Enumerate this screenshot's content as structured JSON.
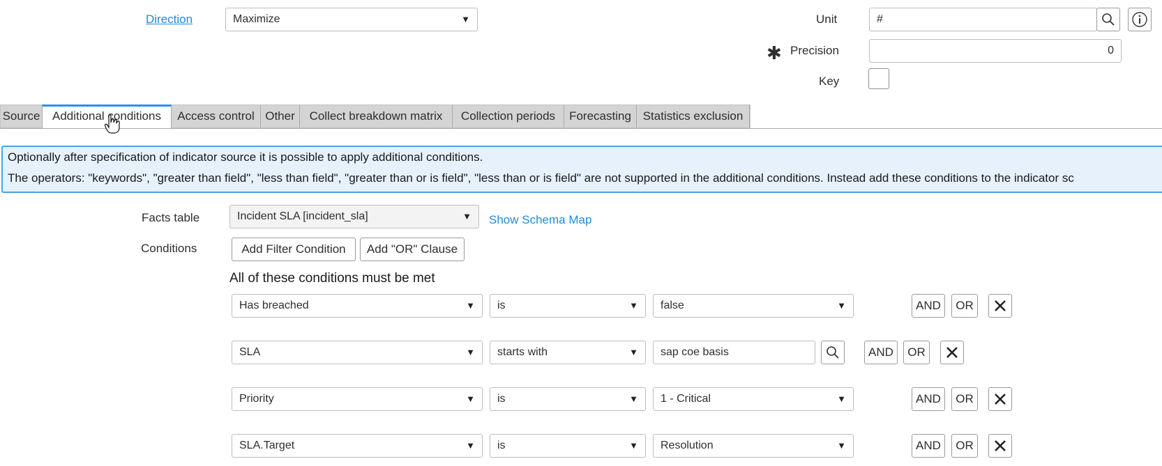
{
  "fields": {
    "direction_label": "Direction",
    "direction_value": "Maximize",
    "unit_label": "Unit",
    "unit_value": "#",
    "precision_label": "Precision",
    "precision_value": "0",
    "key_label": "Key"
  },
  "tabs": [
    {
      "label": "Source"
    },
    {
      "label": "Additional conditions"
    },
    {
      "label": "Access control"
    },
    {
      "label": "Other"
    },
    {
      "label": "Collect breakdown matrix"
    },
    {
      "label": "Collection periods"
    },
    {
      "label": "Forecasting"
    },
    {
      "label": "Statistics exclusion"
    }
  ],
  "info": {
    "line1": "Optionally after specification of indicator source it is possible to apply additional conditions.",
    "line2": "The operators: \"keywords\", \"greater than field\", \"less than field\", \"greater than or is field\", \"less than or is field\" are not supported in the additional conditions. Instead add these conditions to the indicator sc"
  },
  "facts": {
    "label": "Facts table",
    "value": "Incident SLA [incident_sla]",
    "schema_link": "Show Schema Map"
  },
  "conditions": {
    "label": "Conditions",
    "add_filter": "Add Filter Condition",
    "add_or": "Add \"OR\" Clause",
    "heading": "All of these conditions must be met",
    "and_label": "AND",
    "or_label": "OR",
    "rows": [
      {
        "field": "Has breached",
        "operator": "is",
        "value": "false"
      },
      {
        "field": "SLA",
        "operator": "starts with",
        "value": "sap coe basis"
      },
      {
        "field": "Priority",
        "operator": "is",
        "value": "1 - Critical"
      },
      {
        "field": "SLA.Target",
        "operator": "is",
        "value": "Resolution"
      }
    ]
  }
}
